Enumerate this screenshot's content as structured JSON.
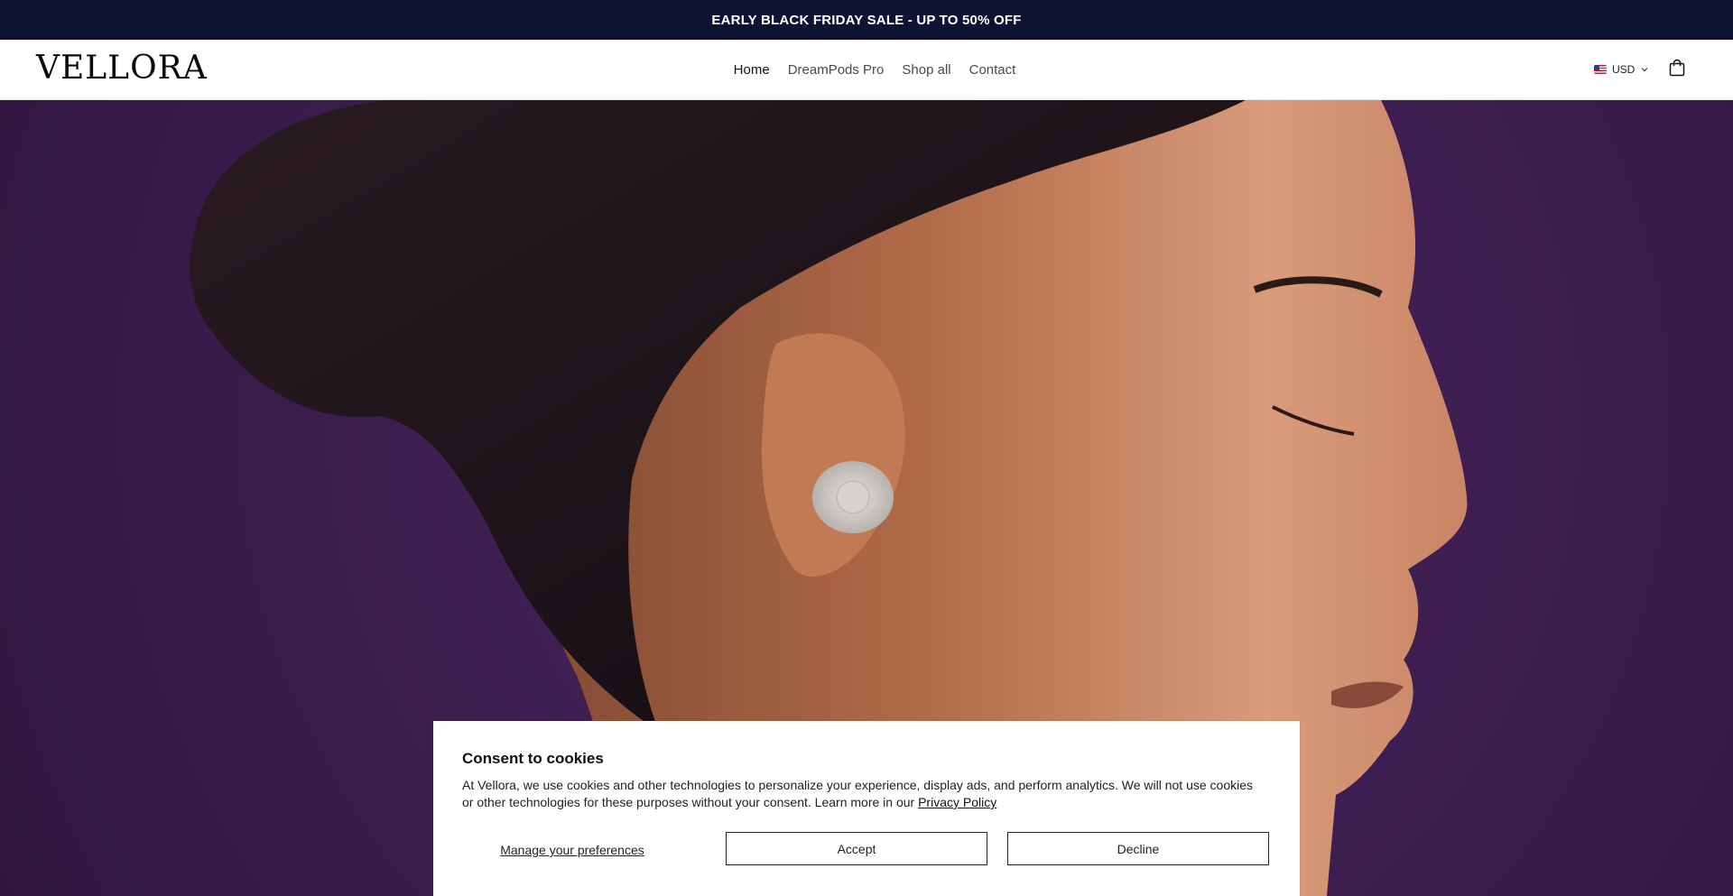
{
  "announcement": {
    "text": "EARLY BLACK FRIDAY SALE - UP TO 50% OFF"
  },
  "header": {
    "logo": "VELLORA",
    "nav": [
      {
        "label": "Home",
        "active": true
      },
      {
        "label": "DreamPods Pro",
        "active": false
      },
      {
        "label": "Shop all",
        "active": false
      },
      {
        "label": "Contact",
        "active": false
      }
    ],
    "currency": {
      "selected": "USD",
      "flag_icon": "us-flag-icon"
    },
    "cart_icon": "shopping-bag-icon"
  },
  "hero": {
    "background_color": "#3f1f52",
    "image_semantic": "hero-image"
  },
  "cookie_banner": {
    "title": "Consent to cookies",
    "text_before_link": "At Vellora, we use cookies and other technologies to personalize your experience, display ads, and perform analytics. We will not use cookies or other technologies for these purposes without your consent. Learn more in our ",
    "link_text": "Privacy Policy",
    "manage_label": "Manage your preferences",
    "accept_label": "Accept",
    "decline_label": "Decline"
  },
  "colors": {
    "announcement_bg": "#0d1333",
    "hero_bg": "#3f1f52",
    "text": "#111111"
  }
}
